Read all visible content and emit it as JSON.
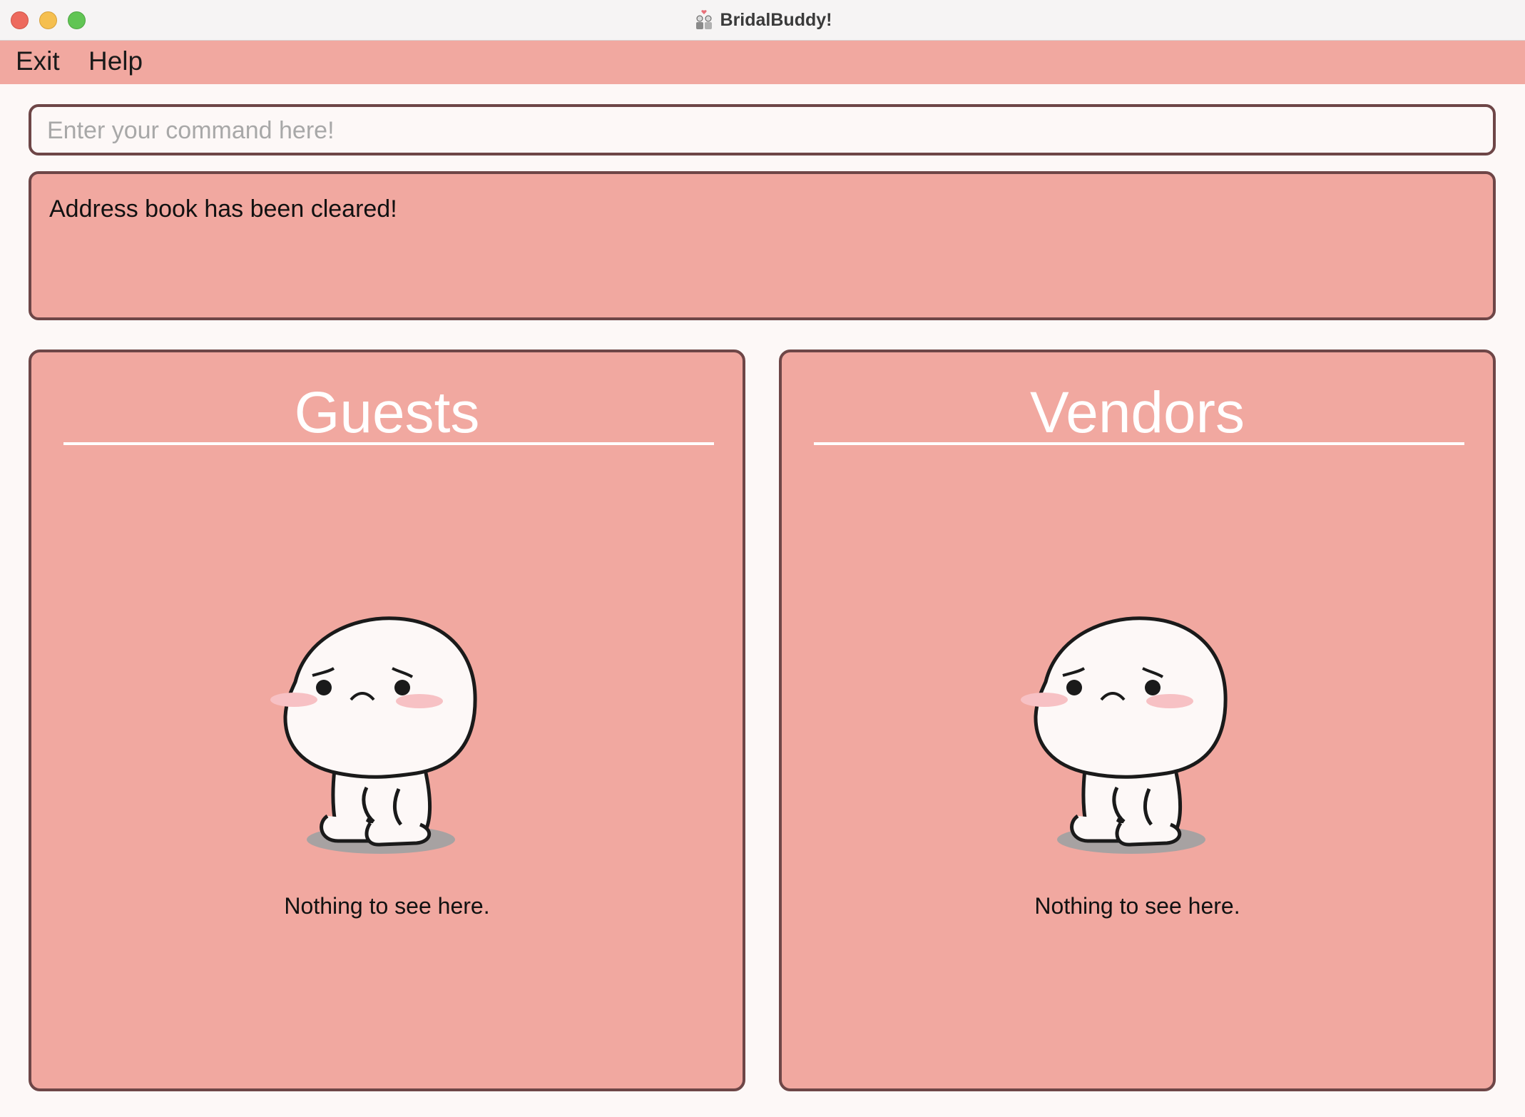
{
  "window": {
    "title": "BridalBuddy!"
  },
  "menu": {
    "exit_label": "Exit",
    "help_label": "Help"
  },
  "command": {
    "placeholder": "Enter your command here!",
    "value": ""
  },
  "result": {
    "message": "Address book has been cleared!"
  },
  "panels": {
    "guests": {
      "title": "Guests",
      "empty_message": "Nothing to see here.",
      "illustration_icon": "sad-mascot-icon"
    },
    "vendors": {
      "title": "Vendors",
      "empty_message": "Nothing to see here.",
      "illustration_icon": "sad-mascot-icon"
    }
  },
  "colors": {
    "accent": "#f1a8a0",
    "border": "#6e4647",
    "background": "#fdf8f7",
    "heading_text": "#ffffff"
  }
}
